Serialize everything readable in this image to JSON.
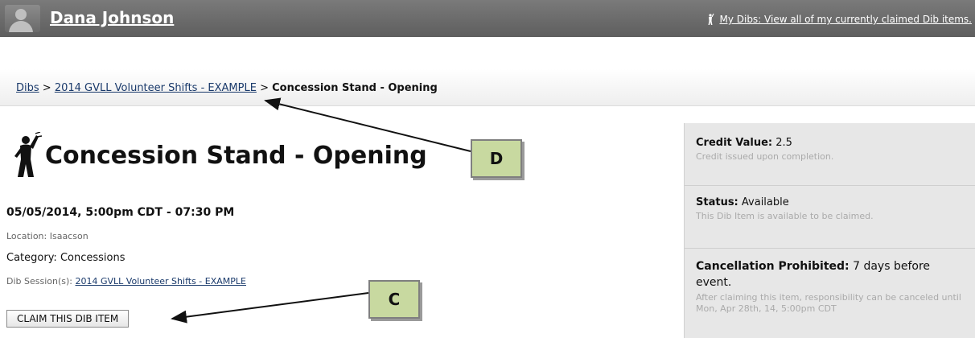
{
  "header": {
    "user_name": "Dana Johnson",
    "my_dibs_link": "My Dibs: View all of my currently claimed Dib items."
  },
  "breadcrumb": {
    "root": "Dibs",
    "separator": " > ",
    "session": "2014 GVLL Volunteer Shifts - EXAMPLE",
    "current": "Concession Stand - Opening"
  },
  "item": {
    "title": "Concession Stand - Opening",
    "datetime": "05/05/2014, 5:00pm CDT - 07:30 PM",
    "location": "Location: Isaacson",
    "category": "Category: Concessions",
    "session_label": "Dib Session(s): ",
    "session_link": "2014 GVLL Volunteer Shifts - EXAMPLE",
    "claim_button": "CLAIM THIS DIB ITEM"
  },
  "callouts": {
    "d": "D",
    "c": "C"
  },
  "side_panel": {
    "credit_label": "Credit Value:",
    "credit_value": " 2.5",
    "credit_note": "Credit issued upon completion.",
    "status_label": "Status:",
    "status_value": " Available",
    "status_note": "This Dib Item is available to be claimed.",
    "cancel_label": "Cancellation Prohibited:",
    "cancel_value": " 7 days before event.",
    "cancel_note": "After claiming this item, responsibility can be canceled until Mon, Apr 28th, 14, 5:00pm CDT"
  },
  "icons": {
    "avatar": "avatar-silhouette-icon",
    "small_wave": "waving-person-icon",
    "title_wave": "waving-person-icon"
  }
}
